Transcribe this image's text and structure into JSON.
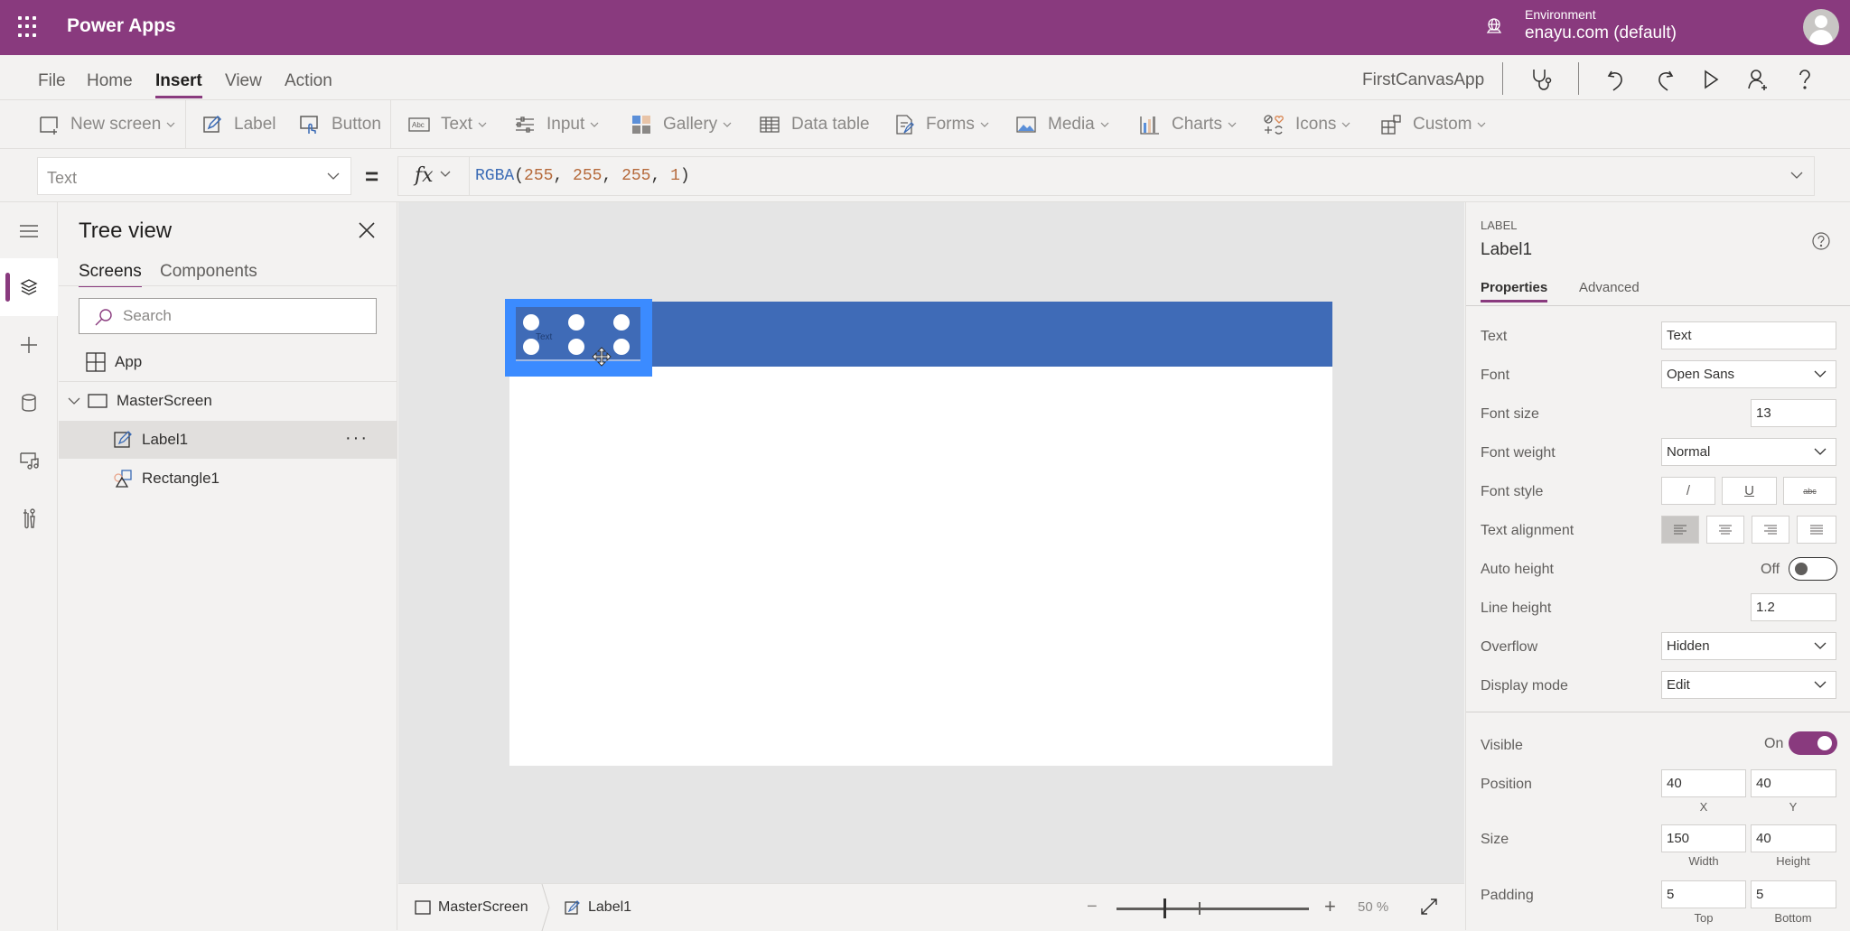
{
  "app": {
    "title": "Power Apps",
    "environment_label": "Environment",
    "environment_value": "enayu.com (default)",
    "brand_color": "#893a7e"
  },
  "menu": {
    "items": [
      {
        "label": "File",
        "active": false
      },
      {
        "label": "Home",
        "active": false
      },
      {
        "label": "Insert",
        "active": true
      },
      {
        "label": "View",
        "active": false
      },
      {
        "label": "Action",
        "active": false
      }
    ],
    "app_name": "FirstCanvasApp",
    "icons": [
      "stethoscope-icon",
      "undo-icon",
      "redo-icon",
      "play-icon",
      "share-user-icon",
      "help-icon"
    ]
  },
  "toolbar": {
    "new_screen": "New screen",
    "label": "Label",
    "button": "Button",
    "text": "Text",
    "input": "Input",
    "gallery": "Gallery",
    "data_table": "Data table",
    "forms": "Forms",
    "media": "Media",
    "charts": "Charts",
    "icons": "Icons",
    "custom": "Custom"
  },
  "formula": {
    "property": "Text",
    "equals": "=",
    "fx": "fx",
    "fn": "RGBA",
    "open": "(",
    "args": [
      "255",
      "255",
      "255",
      "1"
    ],
    "sep": ", ",
    "close": ")"
  },
  "tree": {
    "heading": "Tree view",
    "tabs": [
      {
        "label": "Screens",
        "active": true
      },
      {
        "label": "Components",
        "active": false
      }
    ],
    "search_placeholder": "Search",
    "app_label": "App",
    "screen_label": "MasterScreen",
    "children": [
      {
        "label": "Label1",
        "selected": true,
        "more": "···"
      },
      {
        "label": "Rectangle1",
        "selected": false
      }
    ]
  },
  "canvas": {
    "label_text": "Text",
    "rectangle_color": "#3f6bb7",
    "selection_color": "#3b8bff"
  },
  "bottom": {
    "crumb_screen": "MasterScreen",
    "crumb_control": "Label1",
    "zoom_minus": "−",
    "zoom_plus": "+",
    "zoom_value": "50 %",
    "zoom_percent": 50
  },
  "props": {
    "type": "LABEL",
    "name": "Label1",
    "tabs": [
      {
        "label": "Properties",
        "active": true
      },
      {
        "label": "Advanced",
        "active": false
      }
    ],
    "text_label": "Text",
    "text_value": "Text",
    "font_label": "Font",
    "font_value": "Open Sans",
    "font_size_label": "Font size",
    "font_size_value": "13",
    "font_weight_label": "Font weight",
    "font_weight_value": "Normal",
    "font_style_label": "Font style",
    "font_style_buttons": [
      "/",
      "U",
      "abc"
    ],
    "text_align_label": "Text alignment",
    "auto_height_label": "Auto height",
    "auto_height_state": "Off",
    "line_height_label": "Line height",
    "line_height_value": "1.2",
    "overflow_label": "Overflow",
    "overflow_value": "Hidden",
    "display_mode_label": "Display mode",
    "display_mode_value": "Edit",
    "visible_label": "Visible",
    "visible_state": "On",
    "position_label": "Position",
    "position_x": "40",
    "position_y": "40",
    "x_label": "X",
    "y_label": "Y",
    "size_label": "Size",
    "size_width": "150",
    "size_height": "40",
    "width_label": "Width",
    "height_label": "Height",
    "padding_label": "Padding",
    "padding_top": "5",
    "padding_bottom": "5",
    "top_label": "Top",
    "bottom_label": "Bottom"
  }
}
